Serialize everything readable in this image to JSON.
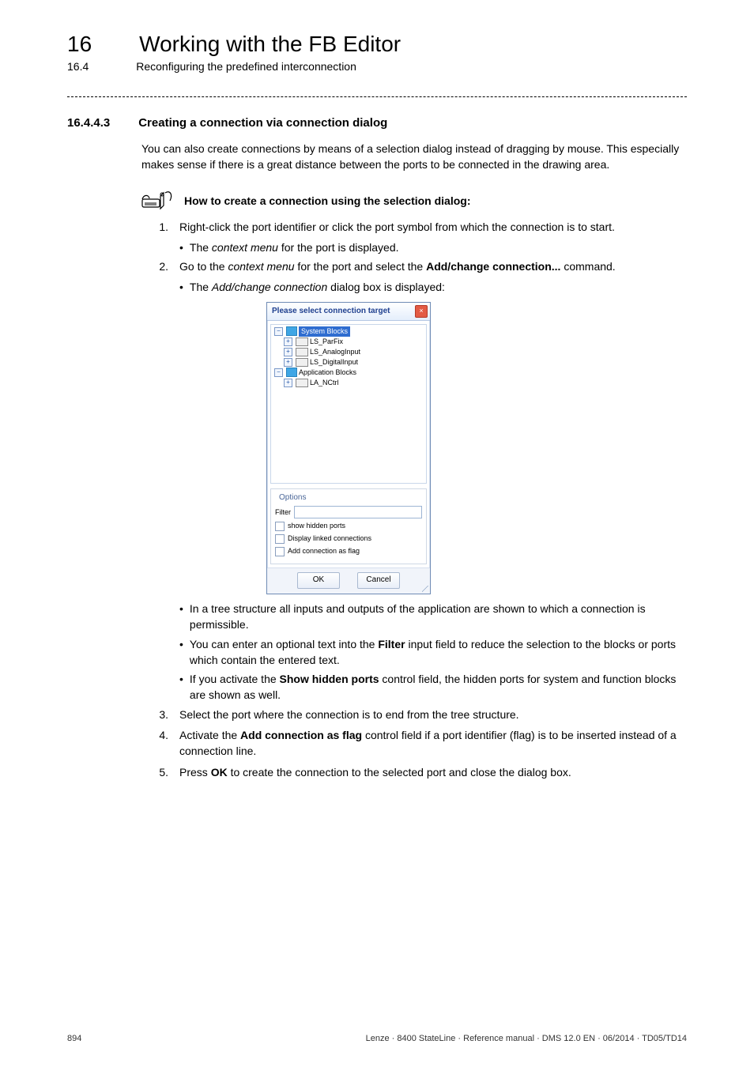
{
  "header": {
    "chapter_number": "16",
    "chapter_title": "Working with the FB Editor",
    "sub_number": "16.4",
    "sub_title": "Reconfiguring the predefined interconnection"
  },
  "section": {
    "number": "16.4.4.3",
    "title": "Creating a connection via connection dialog"
  },
  "intro": "You can also create connections by means of a selection dialog instead of dragging by mouse. This especially makes sense if there is a great distance between the ports to be connected in the drawing area.",
  "howto_title": "How to create a connection using the selection dialog:",
  "steps": {
    "s1_num": "1.",
    "s1_text": "Right-click the port identifier or click the port symbol from which the connection is to start.",
    "s1_b1_pre": "The ",
    "s1_b1_em": "context menu",
    "s1_b1_post": " for the port is displayed.",
    "s2_num": "2.",
    "s2_pre": "Go to the ",
    "s2_em": "context menu",
    "s2_mid": " for the port and select the ",
    "s2_bold": "Add/change connection...",
    "s2_post": " command.",
    "s2_b1_pre": "The ",
    "s2_b1_em": "Add/change connection",
    "s2_b1_post": " dialog box is displayed:",
    "s2_b2": "In a tree structure all inputs and outputs of the application are shown to which a connection is permissible.",
    "s2_b3_pre": "You can enter an optional text into the ",
    "s2_b3_bold": "Filter",
    "s2_b3_post": " input field to reduce the selection to the blocks or ports which contain the entered text.",
    "s2_b4_pre": "If you activate the ",
    "s2_b4_bold": "Show hidden ports",
    "s2_b4_post": " control field, the hidden ports for system and function blocks are shown as well.",
    "s3_num": "3.",
    "s3_text": "Select the port where the connection is to end from the tree structure.",
    "s4_num": "4.",
    "s4_pre": "Activate the ",
    "s4_bold": "Add connection as flag",
    "s4_post": " control field if a port identifier (flag) is to be inserted instead of a connection line.",
    "s5_num": "5.",
    "s5_pre": "Press ",
    "s5_bold": "OK",
    "s5_post": " to create the connection to the selected port and close the dialog box."
  },
  "dialog": {
    "title": "Please select connection target",
    "tree": {
      "n1": "System Blocks",
      "n1a": "LS_ParFix",
      "n1b": "LS_AnalogInput",
      "n1c": "LS_DigitalInput",
      "n2": "Application Blocks",
      "n2a": "LA_NCtrl"
    },
    "options_title": "Options",
    "filter_label": "Filter",
    "chk1": "show hidden ports",
    "chk2": "Display linked connections",
    "chk3": "Add connection as flag",
    "ok": "OK",
    "cancel": "Cancel"
  },
  "footer": {
    "page": "894",
    "right": "Lenze · 8400 StateLine · Reference manual · DMS 12.0 EN · 06/2014 · TD05/TD14"
  }
}
